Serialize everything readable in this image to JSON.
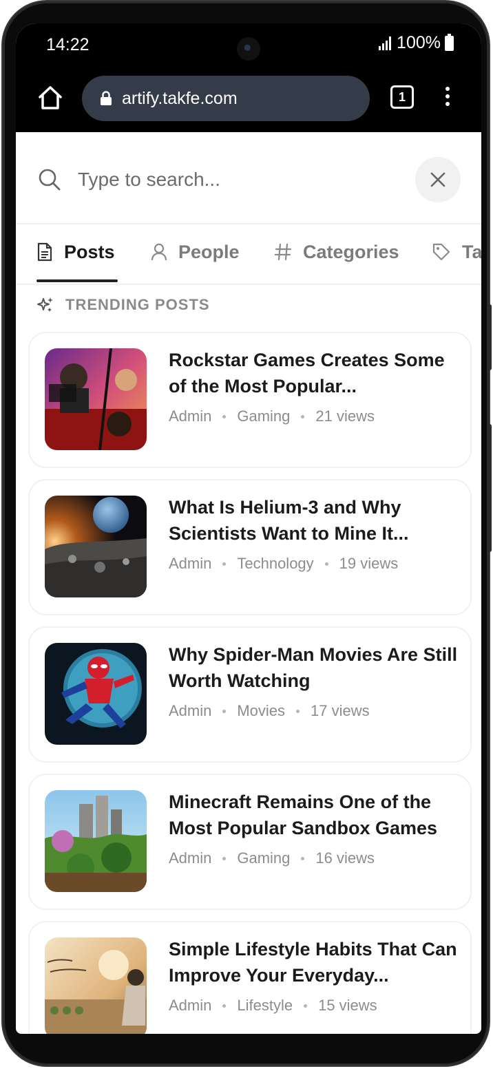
{
  "status_bar": {
    "time": "14:22",
    "battery": "100%"
  },
  "browser": {
    "url": "artify.takfe.com",
    "tab_count": "1"
  },
  "search": {
    "placeholder": "Type to search..."
  },
  "tabs": [
    {
      "label": "Posts",
      "icon": "document-icon",
      "active": true
    },
    {
      "label": "People",
      "icon": "person-icon",
      "active": false
    },
    {
      "label": "Categories",
      "icon": "hash-icon",
      "active": false
    },
    {
      "label": "Ta",
      "icon": "tag-icon",
      "active": false
    }
  ],
  "section": {
    "title": "TRENDING POSTS",
    "icon": "sparkles-icon"
  },
  "posts": [
    {
      "title": "Rockstar Games Creates Some of the Most Popular...",
      "author": "Admin",
      "category": "Gaming",
      "views": "21 views"
    },
    {
      "title": "What Is Helium-3 and Why Scientists Want to Mine It...",
      "author": "Admin",
      "category": "Technology",
      "views": "19 views"
    },
    {
      "title": "Why Spider-Man Movies Are Still Worth Watching",
      "author": "Admin",
      "category": "Movies",
      "views": "17 views"
    },
    {
      "title": "Minecraft Remains One of the Most Popular Sandbox Games",
      "author": "Admin",
      "category": "Gaming",
      "views": "16 views"
    },
    {
      "title": "Simple Lifestyle Habits That Can Improve Your Everyday...",
      "author": "Admin",
      "category": "Lifestyle",
      "views": "15 views"
    }
  ]
}
